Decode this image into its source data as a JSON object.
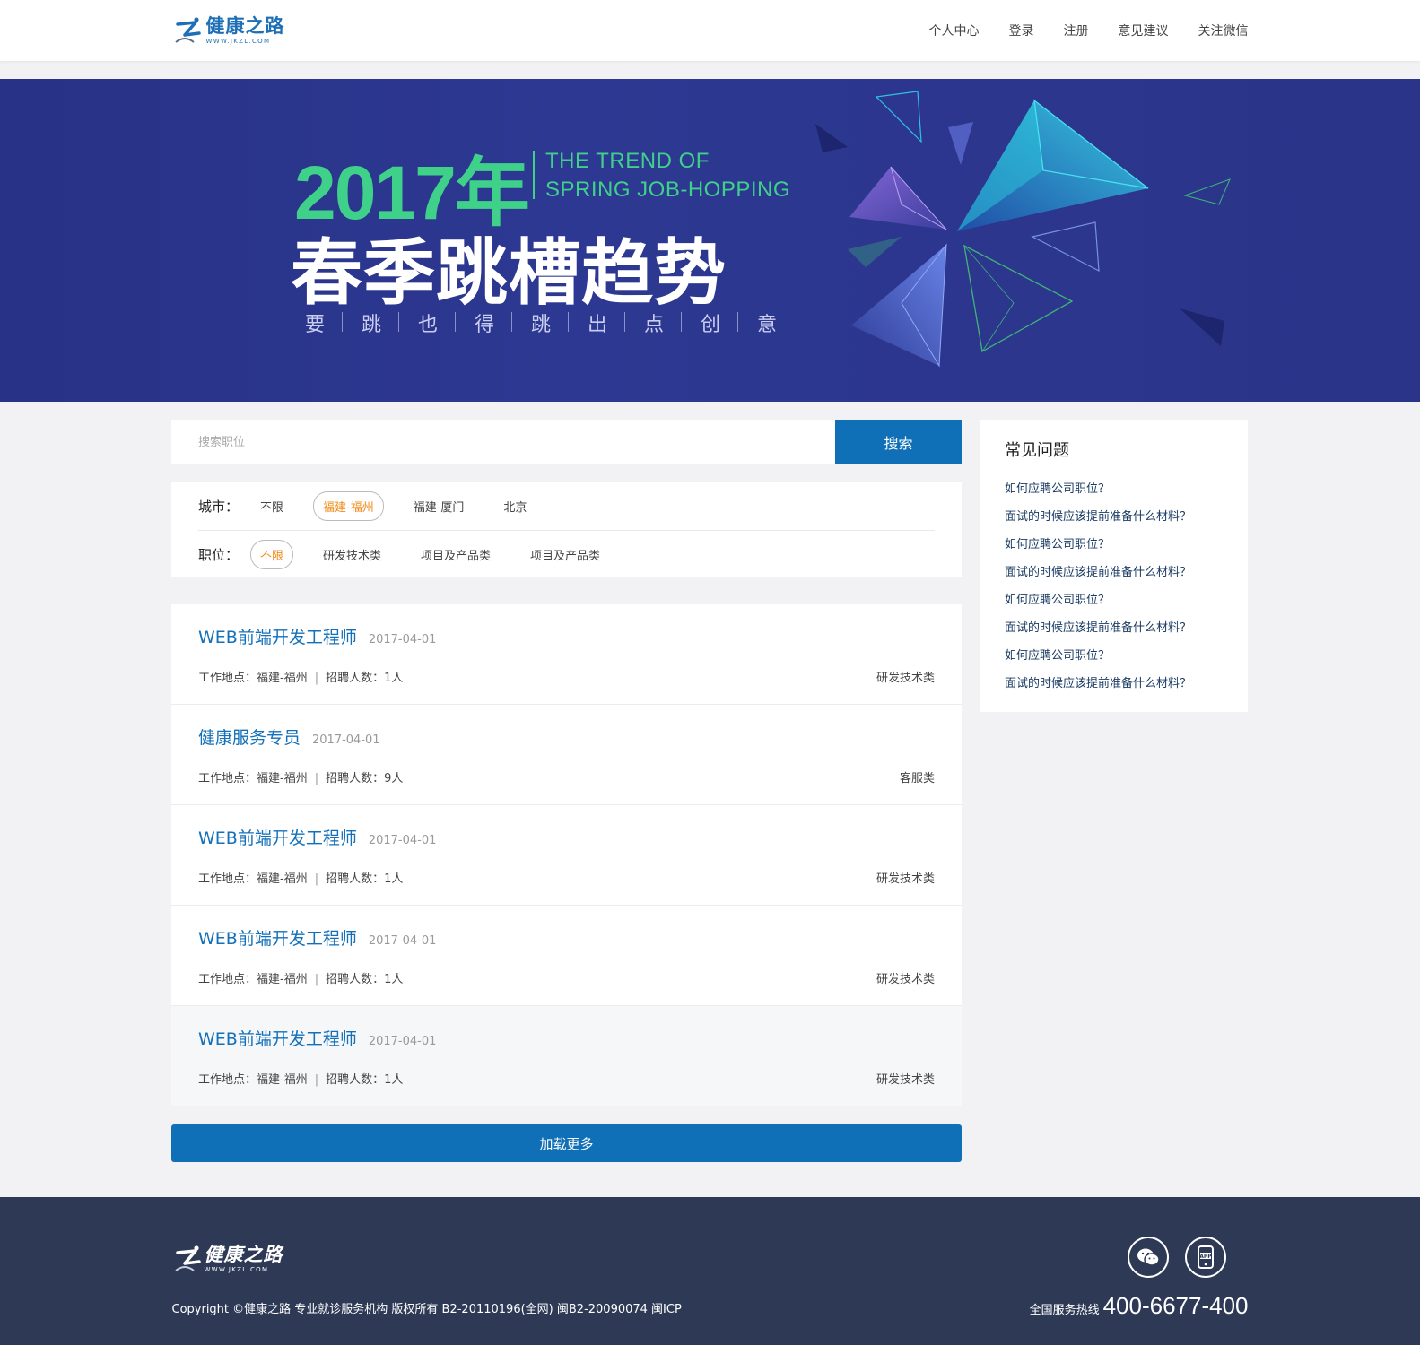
{
  "header": {
    "logo_name": "健康之路",
    "logo_url": "WWW.JKZL.COM",
    "nav": [
      "个人中心",
      "登录",
      "注册",
      "意见建议",
      "关注微信"
    ]
  },
  "banner": {
    "year": "2017年",
    "trend_line1": "THE TREND OF",
    "trend_line2": "SPRING JOB-HOPPING",
    "title": "春季跳槽趋势",
    "subtitle_chars": [
      "要",
      "跳",
      "也",
      "得",
      "跳",
      "出",
      "点",
      "创",
      "意"
    ]
  },
  "search": {
    "placeholder": "搜索职位",
    "button": "搜索"
  },
  "filters": {
    "city_label": "城市：",
    "cities": [
      "不限",
      "福建-福州",
      "福建-厦门",
      "北京"
    ],
    "city_active": "福建-福州",
    "position_label": "职位：",
    "positions": [
      "不限",
      "研发技术类",
      "项目及产品类",
      "项目及产品类"
    ],
    "position_active": "不限"
  },
  "jobs": [
    {
      "title": "WEB前端开发工程师",
      "date": "2017-04-01",
      "location": "工作地点：福建-福州",
      "count": "招聘人数：1人",
      "category": "研发技术类"
    },
    {
      "title": "健康服务专员",
      "date": "2017-04-01",
      "location": "工作地点：福建-福州",
      "count": "招聘人数：9人",
      "category": "客服类"
    },
    {
      "title": "WEB前端开发工程师",
      "date": "2017-04-01",
      "location": "工作地点：福建-福州",
      "count": "招聘人数：1人",
      "category": "研发技术类"
    },
    {
      "title": "WEB前端开发工程师",
      "date": "2017-04-01",
      "location": "工作地点：福建-福州",
      "count": "招聘人数：1人",
      "category": "研发技术类"
    },
    {
      "title": "WEB前端开发工程师",
      "date": "2017-04-01",
      "location": "工作地点：福建-福州",
      "count": "招聘人数：1人",
      "category": "研发技术类"
    }
  ],
  "load_more": "加载更多",
  "faq": {
    "title": "常见问题",
    "items": [
      "如何应聘公司职位？",
      "面试的时候应该提前准备什么材料？",
      "如何应聘公司职位？",
      "面试的时候应该提前准备什么材料？",
      "如何应聘公司职位？",
      "面试的时候应该提前准备什么材料？",
      "如何应聘公司职位？",
      "面试的时候应该提前准备什么材料？"
    ]
  },
  "footer": {
    "logo_name": "健康之路",
    "logo_url": "WWW.JKZL.COM",
    "copyright": "Copyright ©健康之路 专业就诊服务机构 版权所有 B2-20110196(全网) 闽B2-20090074 闽ICP",
    "icons": [
      "wechat-icon",
      "app-icon"
    ],
    "hotline_label": "全国服务热线",
    "hotline": "400-6677-400"
  },
  "colors": {
    "brand_blue": "#0f70b8",
    "banner_bg": "#2d3892",
    "banner_green": "#3fd18a",
    "active_orange": "#f08a16",
    "footer_bg": "#2e3a55"
  }
}
